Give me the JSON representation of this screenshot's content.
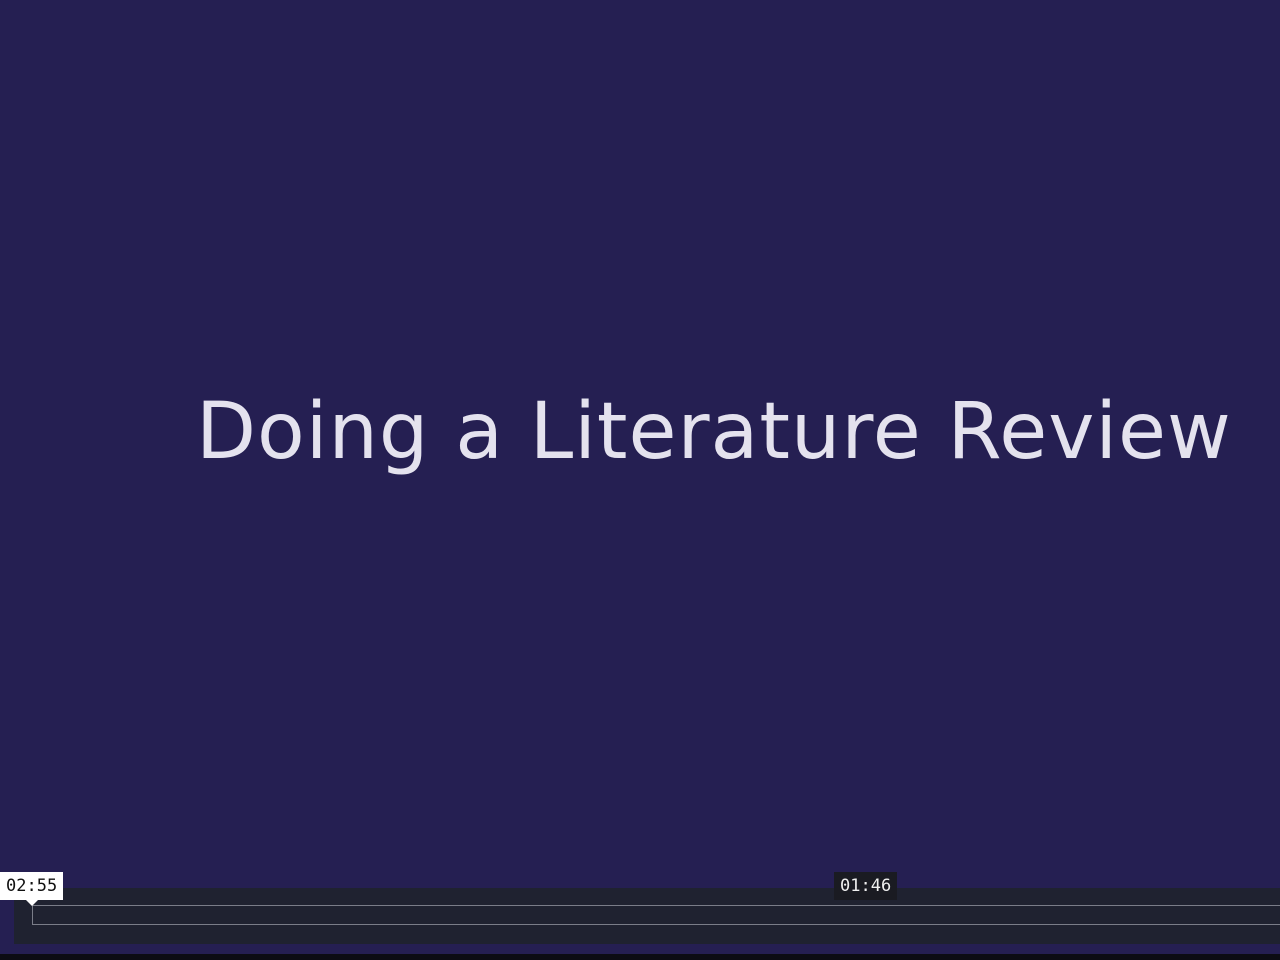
{
  "slide": {
    "title": "Doing a Literature Review"
  },
  "player": {
    "playhead_time": "02:55",
    "hover_time": "01:46"
  },
  "colors": {
    "background": "#251f52",
    "title_text": "#e4e2ee",
    "controls_bg": "#1f2230"
  }
}
